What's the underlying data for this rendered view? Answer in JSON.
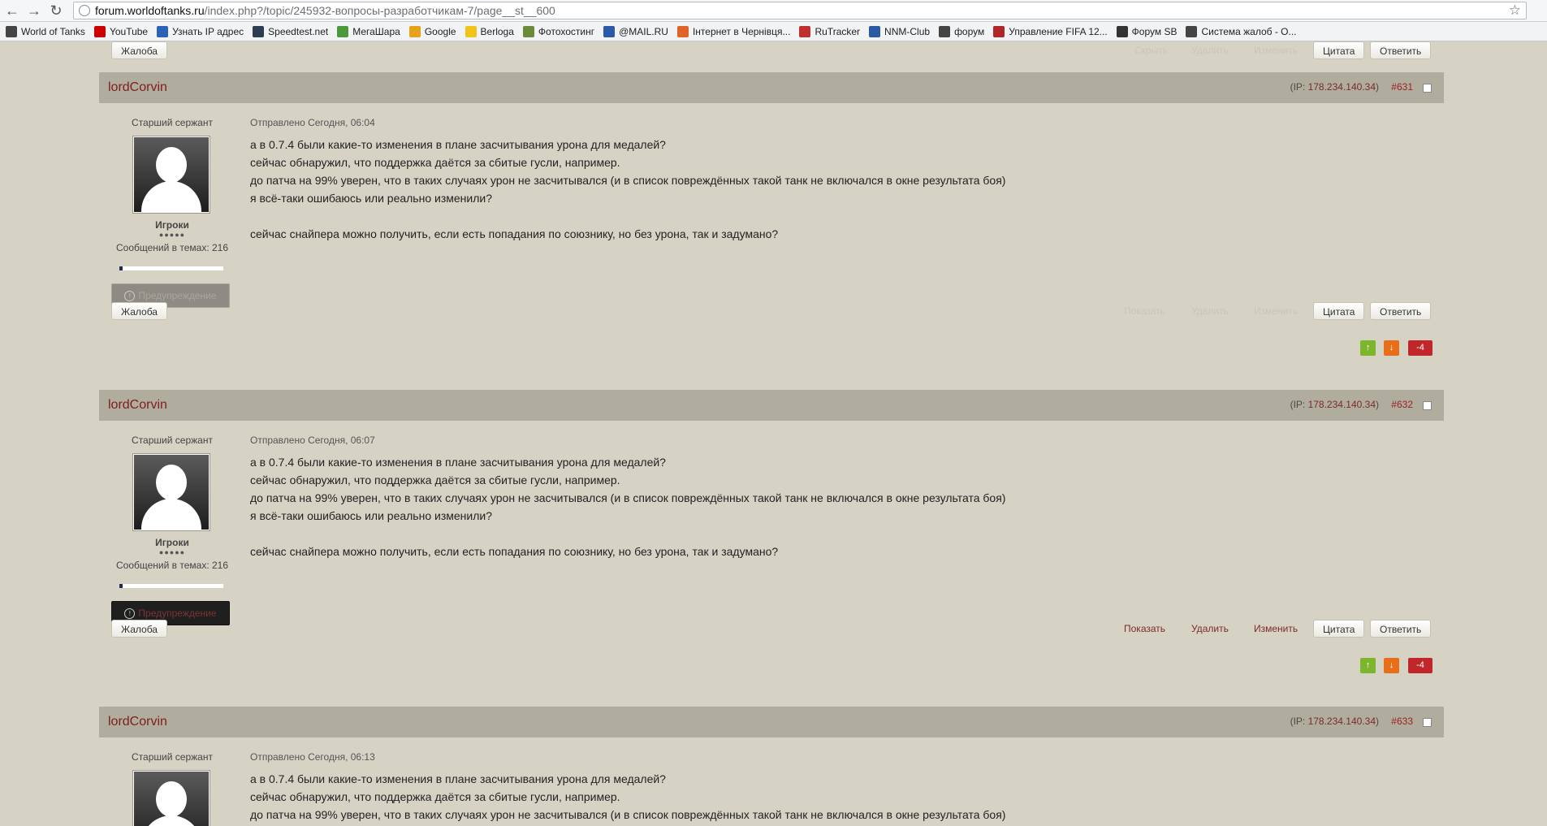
{
  "browser": {
    "url_host": "forum.worldoftanks.ru",
    "url_path": "/index.php?/topic/245932-вопросы-разработчикам-7/page__st__600",
    "bookmarks": [
      {
        "label": "World of Tanks",
        "icon": "tank-icon",
        "color": "#444444"
      },
      {
        "label": "YouTube",
        "icon": "youtube-icon",
        "color": "#cc0000"
      },
      {
        "label": "Узнать IP адрес",
        "icon": "ip-icon",
        "color": "#2a62b8"
      },
      {
        "label": "Speedtest.net",
        "icon": "speedtest-icon",
        "color": "#2d3e52"
      },
      {
        "label": "МегаШара",
        "icon": "check-icon",
        "color": "#4a9a3a"
      },
      {
        "label": "Google",
        "icon": "google-icon",
        "color": "#e8a21a"
      },
      {
        "label": "Berloga",
        "icon": "flag-icon",
        "color": "#f2c318"
      },
      {
        "label": "Фотохостинг",
        "icon": "photo-icon",
        "color": "#6b8a3a"
      },
      {
        "label": "@MAIL.RU",
        "icon": "mail-icon",
        "color": "#2d5aa8"
      },
      {
        "label": "Інтернет в Чернівця...",
        "icon": "network-icon",
        "color": "#e0642a"
      },
      {
        "label": "RuTracker",
        "icon": "rutracker-icon",
        "color": "#c03030"
      },
      {
        "label": "NNM-Club",
        "icon": "nnm-icon",
        "color": "#2a5aa0"
      },
      {
        "label": "форум",
        "icon": "shield-icon",
        "color": "#444444"
      },
      {
        "label": "Управление FIFA 12...",
        "icon": "fifa-icon",
        "color": "#b0262a"
      },
      {
        "label": "Форум SB",
        "icon": "bird-icon",
        "color": "#333333"
      },
      {
        "label": "Система жалоб - О...",
        "icon": "shield-icon",
        "color": "#444444"
      }
    ]
  },
  "actions": {
    "complaint": "Жалоба",
    "hide": "Скрыть",
    "show": "Показать",
    "delete": "Удалить",
    "edit": "Изменить",
    "quote": "Цитата",
    "reply": "Ответить"
  },
  "posts": [
    {
      "author": "lordCorvin",
      "ip_label": "IP:",
      "ip": "178.234.140.34",
      "number": "#631",
      "rank": "Старший сержант",
      "group": "Игроки",
      "pips": "●●●●●",
      "messages": "Сообщений в темах: 216",
      "warning": "Предупреждение",
      "posted": "Отправлено Сегодня, 06:04",
      "reputation": "-4",
      "lines": [
        "а в 0.7.4 были какие-то изменения в плане засчитывания урона для медалей?",
        "сейчас обнаружил, что поддержка даётся за сбитые гусли, например.",
        "до патча на 99% уверен, что в таких случаях урон не засчитывался (и в список повреждённых такой танк не включался в окне результата боя)",
        "я всё-таки ошибаюсь или реально изменили?",
        "",
        "сейчас снайпера можно получить, если есть попадания по союзнику, но без урона, так и задумано?"
      ]
    },
    {
      "author": "lordCorvin",
      "ip_label": "IP:",
      "ip": "178.234.140.34",
      "number": "#632",
      "rank": "Старший сержант",
      "group": "Игроки",
      "pips": "●●●●●",
      "messages": "Сообщений в темах: 216",
      "warning": "Предупреждение",
      "posted": "Отправлено Сегодня, 06:07",
      "reputation": "-4",
      "lines": [
        "а в 0.7.4 были какие-то изменения в плане засчитывания урона для медалей?",
        "сейчас обнаружил, что поддержка даётся за сбитые гусли, например.",
        "до патча на 99% уверен, что в таких случаях урон не засчитывался (и в список повреждённых такой танк не включался в окне результата боя)",
        "я всё-таки ошибаюсь или реально изменили?",
        "",
        "сейчас снайпера можно получить, если есть попадания по союзнику, но без урона, так и задумано?"
      ]
    },
    {
      "author": "lordCorvin",
      "ip_label": "IP:",
      "ip": "178.234.140.34",
      "number": "#633",
      "rank": "Старший сержант",
      "posted": "Отправлено Сегодня, 06:13",
      "lines": [
        "а в 0.7.4 были какие-то изменения в плане засчитывания урона для медалей?",
        "сейчас обнаружил, что поддержка даётся за сбитые гусли, например.",
        "до патча на 99% уверен, что в таких случаях урон не засчитывался (и в список повреждённых такой танк не включался в окне результата боя)"
      ]
    }
  ]
}
